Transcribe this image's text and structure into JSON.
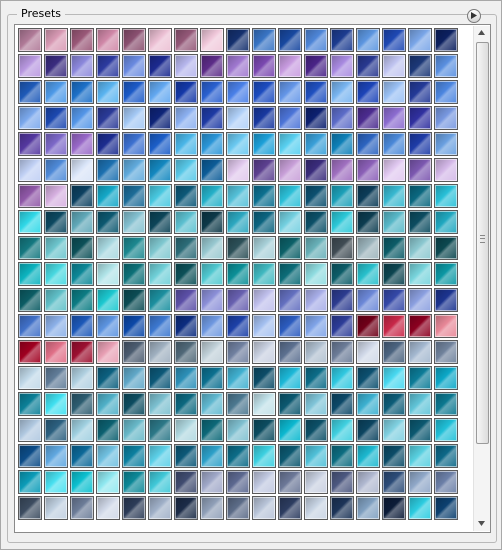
{
  "panel": {
    "title": "Presets"
  },
  "icons": {
    "menu": "flyout-menu-icon",
    "scroll_up": "scroll-up-arrow-icon",
    "scroll_down": "scroll-down-arrow-icon",
    "grip": "scrollbar-grip-icon"
  },
  "swatches": [
    [
      "#b07a98",
      "#d89ab4",
      "#9a5878",
      "#d088a8",
      "#8a5070",
      "#ecc0d4",
      "#945878",
      "#f0c8da",
      "#14306e",
      "#3874c4",
      "#1848a0",
      "#4e86d8",
      "#1c3c90",
      "#5c96e0",
      "#1e48b4",
      "#7aa6e8",
      "#0c2060"
    ],
    [
      "#b898e0",
      "#3a2c80",
      "#8c88dc",
      "#2c3aa0",
      "#6a8ae0",
      "#1c2a90",
      "#b6b6ec",
      "#5c2c88",
      "#a078d0",
      "#7a48b0",
      "#c89ce0",
      "#4a2488",
      "#a88ae0",
      "#283890",
      "#c0c4f0",
      "#1c3878",
      "#5a90e0"
    ],
    [
      "#1e5ab8",
      "#4e9ae8",
      "#1c70c8",
      "#5ab4f0",
      "#1c5ac8",
      "#62a8f0",
      "#1438a8",
      "#2a60d0",
      "#4a80e8",
      "#1c4cc0",
      "#6496e8",
      "#2050c0",
      "#78b4f0",
      "#1c44b8",
      "#9ac0f4",
      "#243a98",
      "#4c86e0"
    ],
    [
      "#7aa8ec",
      "#1c48b0",
      "#5496e8",
      "#2a3a98",
      "#a4c8f4",
      "#0e2478",
      "#8cb0f0",
      "#1e3aa4",
      "#b0d0f8",
      "#1838a0",
      "#4c74d8",
      "#0c2070",
      "#5c6cc8",
      "#4c2c90",
      "#8c6cd0",
      "#3030a0",
      "#7898e0"
    ],
    [
      "#5438a0",
      "#7c68c8",
      "#9868c8",
      "#1c2c90",
      "#3c70d0",
      "#1c5ec8",
      "#4ab6e8",
      "#2a96d8",
      "#6ac8f0",
      "#1ca0d8",
      "#58d0f0",
      "#3aa0d8",
      "#0e80b8",
      "#2c64c0",
      "#4a88d8",
      "#1e3ca8",
      "#6aa0e0"
    ],
    [
      "#c0d0f4",
      "#4e8ad8",
      "#d8e4f8",
      "#1c70b0",
      "#60aadc",
      "#1488c0",
      "#58c8e8",
      "#0c5c98",
      "#e0c8ec",
      "#5c4090",
      "#c8a0d8",
      "#3a2c7c",
      "#a070c0",
      "#8c60b8",
      "#e0c8f0",
      "#7c58b0",
      "#d4b8e8"
    ],
    [
      "#9058a8",
      "#d6b0e0",
      "#0c4060",
      "#14a8c8",
      "#1c6c98",
      "#48c8e0",
      "#0c5878",
      "#24b0c8",
      "#54c0d8",
      "#0c7090",
      "#2cc0d8",
      "#0c5070",
      "#1ca0b8",
      "#0c3c58",
      "#38b8d0",
      "#0a6880",
      "#28c0d8"
    ],
    [
      "#30d8e8",
      "#0c4860",
      "#60a8b8",
      "#0c5870",
      "#84c0d0",
      "#0c4458",
      "#5cc0d0",
      "#0c3848",
      "#2ca8c0",
      "#0c6480",
      "#74d0e0",
      "#0c5068",
      "#2cc8d8",
      "#0c3c50",
      "#58b8c8",
      "#0c4c60",
      "#20a8c0"
    ],
    [
      "#147880",
      "#6cc4cc",
      "#0c5058",
      "#a8d8e0",
      "#1c8890",
      "#80c8d0",
      "#2c6c78",
      "#98c8d0",
      "#2c5058",
      "#a8d0d8",
      "#0c6068",
      "#68b0b8",
      "#404c54",
      "#9cb4bc",
      "#0c5c68",
      "#8cc8d0",
      "#0c4850"
    ],
    [
      "#0cb4c0",
      "#48d8e0",
      "#0c8898",
      "#b0e4e8",
      "#0c7078",
      "#70d0d8",
      "#0c5058",
      "#50c8d0",
      "#0c9098",
      "#40b8c0",
      "#0c6c78",
      "#90dce0",
      "#0c5c68",
      "#28c0cc",
      "#0c4450",
      "#78d4dc",
      "#0c98a4"
    ],
    [
      "#0c5c64",
      "#60c0c8",
      "#0c7c84",
      "#1cc8d0",
      "#0c4c54",
      "#1c90a0",
      "#5c50a8",
      "#8c90d8",
      "#6860b0",
      "#c0c0ec",
      "#6470c0",
      "#a8aee8",
      "#2c3c90",
      "#6c88d8",
      "#3448a8",
      "#8ca0e0",
      "#1c3490"
    ],
    [
      "#4070c8",
      "#8cb0e8",
      "#1c58b8",
      "#5c94e0",
      "#0c48a8",
      "#3c78d0",
      "#0c2c80",
      "#6e98e0",
      "#1c40a8",
      "#a4c0f0",
      "#2c5cc0",
      "#80a4e8",
      "#2c3c98",
      "#700018",
      "#c82848",
      "#8c0020",
      "#e88898"
    ],
    [
      "#a00020",
      "#e07088",
      "#9c1030",
      "#e8a0b4",
      "#4c5c70",
      "#a0b0c0",
      "#506878",
      "#c0d0d8",
      "#7080a0",
      "#c8d0e0",
      "#5c7090",
      "#b0c0d0",
      "#6c7c98",
      "#d0d8e8",
      "#4c6480",
      "#a4b8d0",
      "#70829c"
    ],
    [
      "#c0d8e8",
      "#607c98",
      "#b0d0e0",
      "#0c6080",
      "#60a8c8",
      "#0c5878",
      "#2c90b8",
      "#0c7090",
      "#40b0d0",
      "#0c4c68",
      "#1cb8d8",
      "#0c6c88",
      "#30c8e0",
      "#0c5070",
      "#48d8f0",
      "#0c7c98",
      "#0ca8c8"
    ],
    [
      "#0c8098",
      "#40e0f0",
      "#2c5c70",
      "#50b0c8",
      "#0c4c60",
      "#7cc0d0",
      "#0c6880",
      "#60b8d0",
      "#4c7890",
      "#c0e0e8",
      "#0c5870",
      "#80c4d8",
      "#0c4868",
      "#3cb0d0",
      "#0c5c78",
      "#60c4d8",
      "#0c7890"
    ],
    [
      "#b0c8e0",
      "#2c6080",
      "#a0d0e0",
      "#0c6070",
      "#68b8c8",
      "#2c7888",
      "#b0d8e0",
      "#0c6878",
      "#80c0d0",
      "#0c4c60",
      "#0cb8d0",
      "#0c5068",
      "#40d0e0",
      "#0c4460",
      "#80d0e0",
      "#0c5870",
      "#20c0d8"
    ],
    [
      "#0c4c88",
      "#60a8e0",
      "#0c6898",
      "#70c0e0",
      "#0c80a0",
      "#5cd0e8",
      "#0c5878",
      "#2ca0c8",
      "#0c6c88",
      "#3cd0e0",
      "#0c5870",
      "#50c0d8",
      "#0c6c80",
      "#1cb8d0",
      "#0c4c68",
      "#58d0e0",
      "#0c6888"
    ],
    [
      "#0c9cb8",
      "#48e0f0",
      "#0cc0d0",
      "#90e8f0",
      "#0c8898",
      "#40c8d8",
      "#404c70",
      "#a0a8c8",
      "#5c6890",
      "#c0c8e0",
      "#6c7898",
      "#c8d0e0",
      "#4c5880",
      "#b0b8d0",
      "#2c4c78",
      "#90a8c8",
      "#6c80a8"
    ],
    [
      "#3c4c60",
      "#c0d0e0",
      "#6c7c98",
      "#d0d8e8",
      "#2c3c58",
      "#a0b0c8",
      "#1c2c48",
      "#90a0b8",
      "#5c6c88",
      "#b8c4d8",
      "#2c3c60",
      "#c8d4e4",
      "#1c3458",
      "#80a0c0",
      "#0c1c38",
      "#2ccce0",
      "#0c4070"
    ]
  ]
}
